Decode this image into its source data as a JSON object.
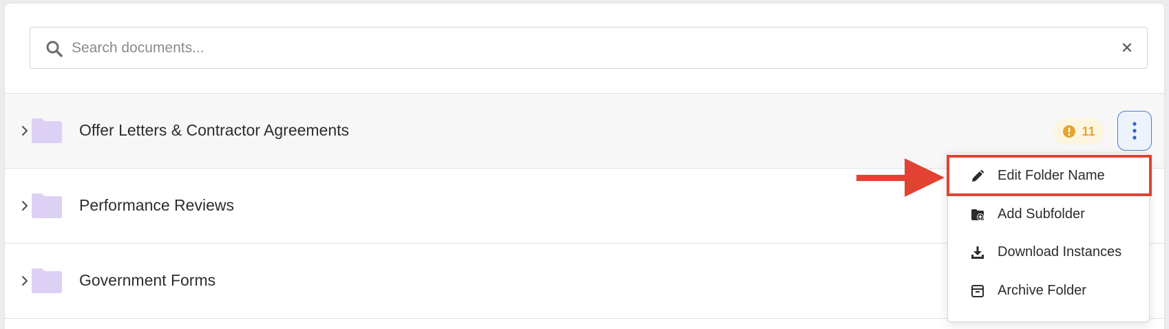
{
  "search": {
    "placeholder": "Search documents...",
    "value": ""
  },
  "folders": [
    {
      "label": "Offer Letters & Contractor Agreements",
      "alert_count": "11",
      "active": true
    },
    {
      "label": "Performance Reviews"
    },
    {
      "label": "Government Forms"
    }
  ],
  "context_menu": {
    "items": [
      {
        "label": "Edit Folder Name",
        "icon": "pencil-icon"
      },
      {
        "label": "Add Subfolder",
        "icon": "folder-add-icon"
      },
      {
        "label": "Download Instances",
        "icon": "download-icon"
      },
      {
        "label": "Archive Folder",
        "icon": "archive-icon"
      }
    ]
  },
  "colors": {
    "folder": "#ddd0f5",
    "badge_bg": "#fdf5df",
    "badge_text": "#e4a42e",
    "accent": "#4a7bd0",
    "highlight": "#e24232"
  }
}
